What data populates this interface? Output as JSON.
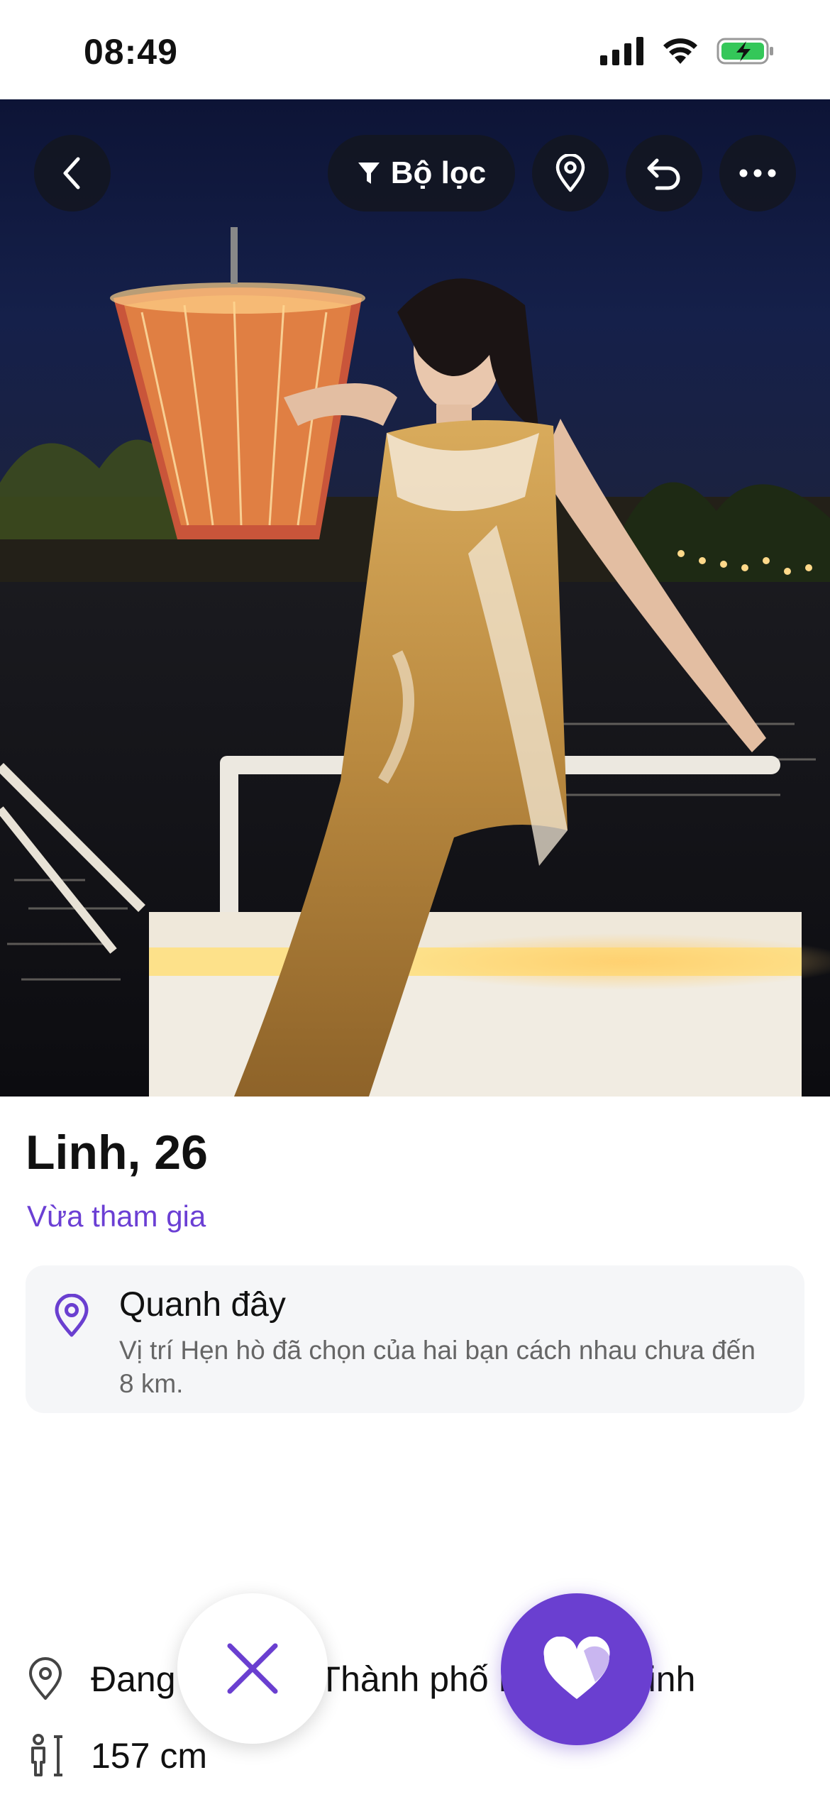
{
  "status": {
    "time": "08:49",
    "icons": [
      "cellular-signal-icon",
      "wifi-icon",
      "battery-charging-icon"
    ]
  },
  "toolbar": {
    "back_icon": "chevron-left-icon",
    "filter_label": "Bộ lọc",
    "filter_icon": "filter-icon",
    "location_icon": "location-pin-icon",
    "undo_icon": "undo-icon",
    "more_icon": "more-horizontal-icon"
  },
  "profile": {
    "name_age": "Linh, 26",
    "joined_status": "Vừa tham gia",
    "nearby": {
      "title": "Quanh đây",
      "description": "Vị trí Hẹn hò đã chọn của hai bạn cách nhau chưa đến 8 km.",
      "icon": "location-pin-icon"
    },
    "details": [
      {
        "icon": "location-pin-icon",
        "text": "Đang sống tại Thành phố Hồ Chí Minh"
      },
      {
        "icon": "height-icon",
        "text": "157 cm"
      }
    ]
  },
  "actions": {
    "pass_icon": "close-icon",
    "like_icon": "heart-icon"
  },
  "colors": {
    "accent": "#6A3FD0",
    "card_bg": "#F5F6F8",
    "toolbar_button_bg": "#14161E"
  }
}
